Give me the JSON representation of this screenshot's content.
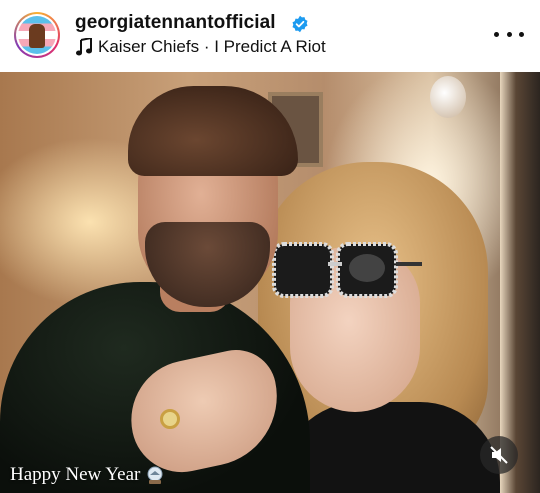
{
  "post": {
    "username": "georgiatennantofficial",
    "verified_icon": "verified-badge-icon",
    "music_icon": "music-note-icon",
    "song": "Kaiser Chiefs · I Predict A Riot",
    "more_icon": "more-options-icon"
  },
  "media": {
    "caption": "Happy New Year",
    "caption_emoji": "snow-globe-icon",
    "mute_icon": "speaker-muted-icon"
  },
  "colors": {
    "verified": "#1d9bf0",
    "text": "#111111"
  }
}
